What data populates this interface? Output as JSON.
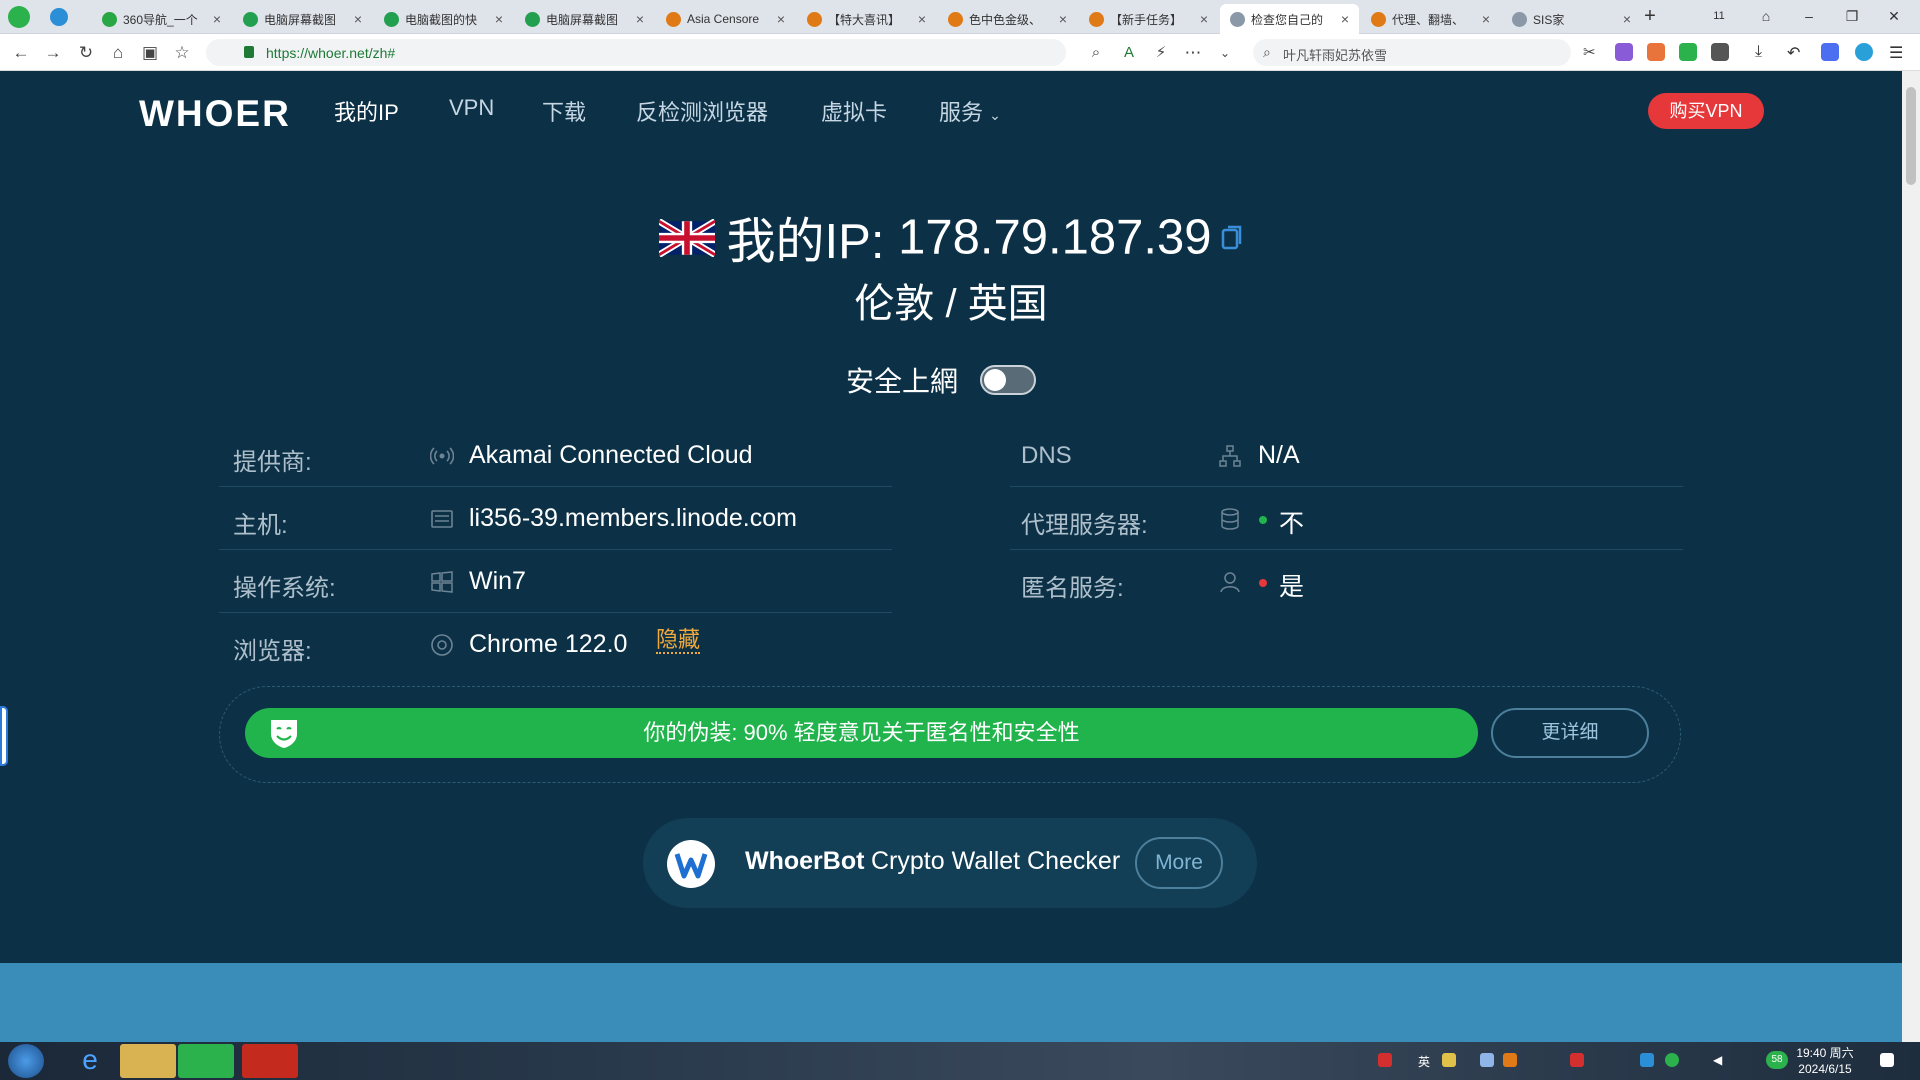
{
  "browser": {
    "tabs": [
      {
        "label": "360导航_一个",
        "color": "#29a745"
      },
      {
        "label": "电脑屏幕截图",
        "color": "#22a050"
      },
      {
        "label": "电脑截图的快",
        "color": "#22a050"
      },
      {
        "label": "电脑屏幕截图",
        "color": "#22a050"
      },
      {
        "label": "Asia Censore",
        "color": "#e07a16"
      },
      {
        "label": "【特大喜讯】",
        "color": "#e07a16"
      },
      {
        "label": "色中色金级、",
        "color": "#e07a16"
      },
      {
        "label": "【新手任务】",
        "color": "#e07a16"
      },
      {
        "label": "检查您自己的",
        "color": "#8a98a8"
      },
      {
        "label": "代理、翻墙、",
        "color": "#e07a16"
      },
      {
        "label": "SIS家",
        "color": "#8a98a8"
      }
    ],
    "tab_count": "11",
    "url": "https://whoer.net/zh#",
    "search_text": "叶凡轩雨妃苏依雪"
  },
  "site": {
    "logo": "WHOER",
    "nav": [
      "我的IP",
      "VPN",
      "下载",
      "反检测浏览器",
      "虚拟卡",
      "服务"
    ],
    "buy_button": "购买VPN"
  },
  "ip_panel": {
    "label": "我的IP:",
    "ip": "178.79.187.39",
    "location": "伦敦 / 英国",
    "safe_label": "安全上網",
    "safe_on": false
  },
  "info_left": [
    {
      "key": "提供商:",
      "value": "Akamai Connected Cloud",
      "icon": "signal-icon"
    },
    {
      "key": "主机:",
      "value": "li356-39.members.linode.com",
      "icon": "server-icon"
    },
    {
      "key": "操作系统:",
      "value": "Win7",
      "icon": "windows-icon"
    },
    {
      "key": "浏览器:",
      "value": "Chrome 122.0",
      "icon": "chrome-icon"
    }
  ],
  "info_right": [
    {
      "key": "DNS",
      "value": "N/A",
      "icon": "network-icon"
    },
    {
      "key": "代理服务器:",
      "value": "不",
      "icon": "database-icon",
      "status_color": "#21b44c"
    },
    {
      "key": "匿名服务:",
      "value": "是",
      "icon": "user-icon",
      "status_color": "#e6383b"
    }
  ],
  "hide_link": "隐藏",
  "disguise": {
    "text": "你的伪装: 90% 轻度意见关于匿名性和安全性",
    "percent": 90,
    "details_button": "更详细"
  },
  "whoerbot": {
    "name": "WhoerBot",
    "desc": "Crypto Wallet Checker",
    "more": "More"
  },
  "taskbar": {
    "clock_time": "19:40 周六",
    "clock_date": "2024/6/15",
    "ime": "英",
    "badge": "58"
  }
}
